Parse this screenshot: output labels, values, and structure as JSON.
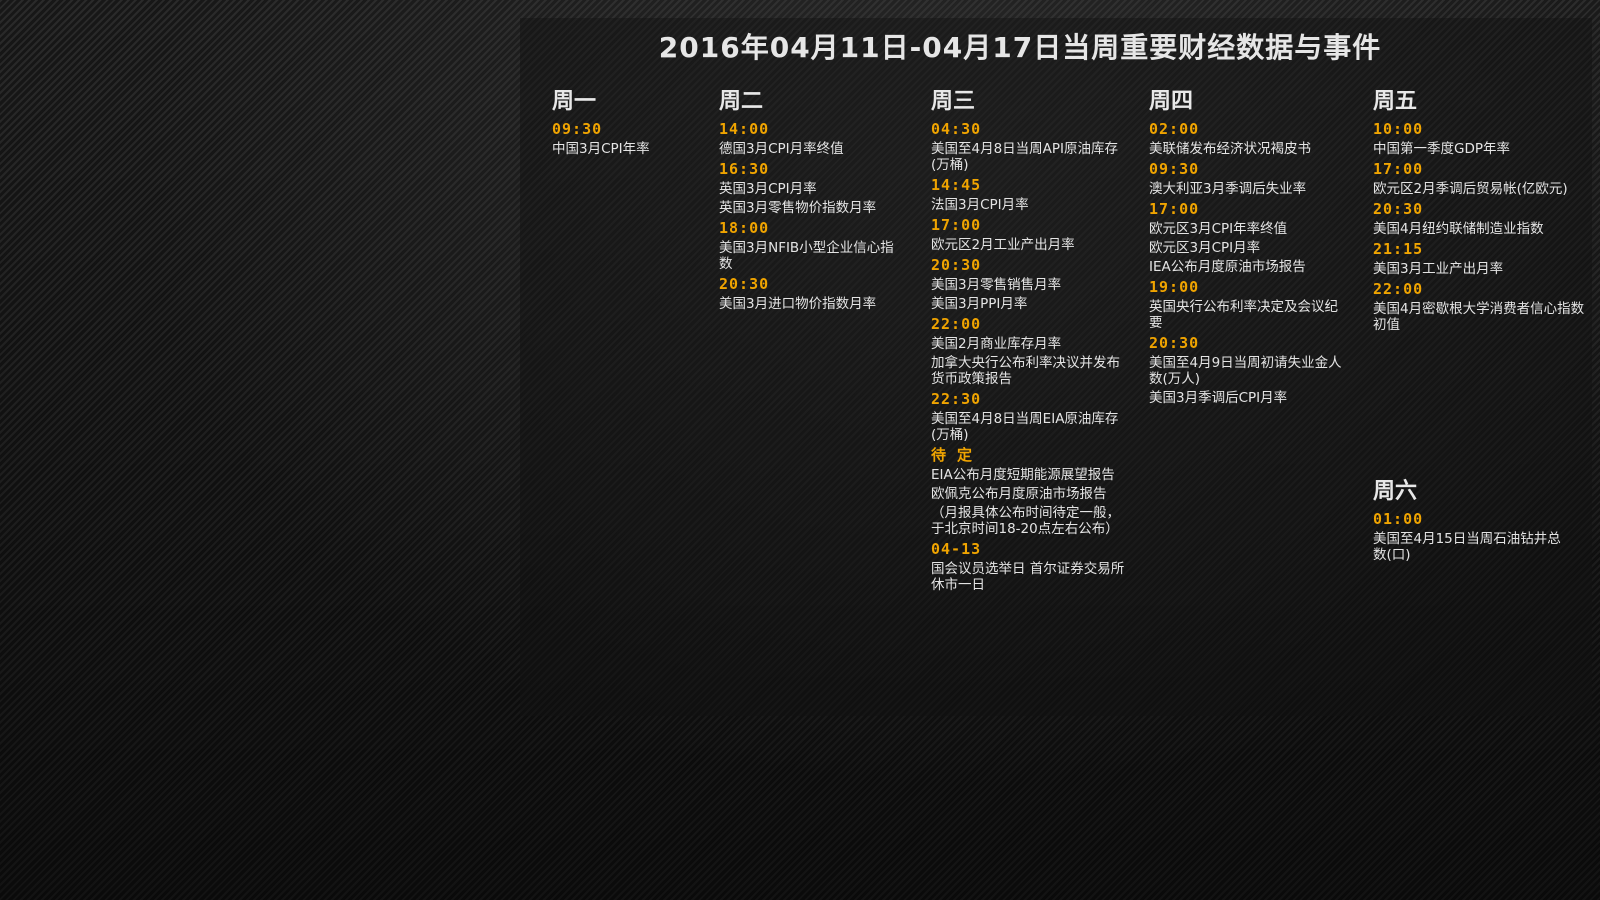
{
  "title": "2016年04月11日-04月17日当周重要财经数据与事件",
  "days": [
    {
      "name": "周一",
      "groups": [
        {
          "time": "09:30",
          "items": [
            "中国3月CPI年率"
          ]
        }
      ]
    },
    {
      "name": "周二",
      "groups": [
        {
          "time": "14:00",
          "items": [
            "德国3月CPI月率终值"
          ]
        },
        {
          "time": "16:30",
          "items": [
            "英国3月CPI月率",
            "英国3月零售物价指数月率"
          ]
        },
        {
          "time": "18:00",
          "items": [
            "美国3月NFIB小型企业信心指数"
          ]
        },
        {
          "time": "20:30",
          "items": [
            "美国3月进口物价指数月率"
          ]
        }
      ]
    },
    {
      "name": "周三",
      "groups": [
        {
          "time": "04:30",
          "items": [
            "美国至4月8日当周API原油库存(万桶)"
          ]
        },
        {
          "time": "14:45",
          "items": [
            "法国3月CPI月率"
          ]
        },
        {
          "time": "17:00",
          "items": [
            "欧元区2月工业产出月率"
          ]
        },
        {
          "time": "20:30",
          "items": [
            "美国3月零售销售月率",
            "美国3月PPI月率"
          ]
        },
        {
          "time": "22:00",
          "items": [
            "美国2月商业库存月率",
            "加拿大央行公布利率决议并发布货币政策报告"
          ]
        },
        {
          "time": "22:30",
          "items": [
            "美国至4月8日当周EIA原油库存(万桶)"
          ]
        },
        {
          "time": "待 定",
          "items": [
            "EIA公布月度短期能源展望报告",
            "欧佩克公布月度原油市场报告",
            "（月报具体公布时间待定一般，于北京时间18-20点左右公布）"
          ]
        },
        {
          "time": "04-13",
          "items": [
            "国会议员选举日 首尔证券交易所 休市一日"
          ]
        }
      ]
    },
    {
      "name": "周四",
      "groups": [
        {
          "time": "02:00",
          "items": [
            "美联储发布经济状况褐皮书"
          ]
        },
        {
          "time": "09:30",
          "items": [
            "澳大利亚3月季调后失业率"
          ]
        },
        {
          "time": "17:00",
          "items": [
            "欧元区3月CPI年率终值",
            "欧元区3月CPI月率",
            "IEA公布月度原油市场报告"
          ]
        },
        {
          "time": "19:00",
          "items": [
            "英国央行公布利率决定及会议纪要"
          ]
        },
        {
          "time": "20:30",
          "items": [
            "美国至4月9日当周初请失业金人数(万人)",
            "美国3月季调后CPI月率"
          ]
        }
      ]
    },
    {
      "name": "周五",
      "groups": [
        {
          "time": "10:00",
          "items": [
            "中国第一季度GDP年率"
          ]
        },
        {
          "time": "17:00",
          "items": [
            "欧元区2月季调后贸易帐(亿欧元)"
          ]
        },
        {
          "time": "20:30",
          "items": [
            "美国4月纽约联储制造业指数"
          ]
        },
        {
          "time": "21:15",
          "items": [
            "美国3月工业产出月率"
          ]
        },
        {
          "time": "22:00",
          "items": [
            "美国4月密歇根大学消费者信心指数初值"
          ]
        }
      ]
    },
    {
      "name": "周六",
      "groups": [
        {
          "time": "01:00",
          "items": [
            "美国至4月15日当周石油钻井总数(口)"
          ]
        }
      ]
    }
  ]
}
